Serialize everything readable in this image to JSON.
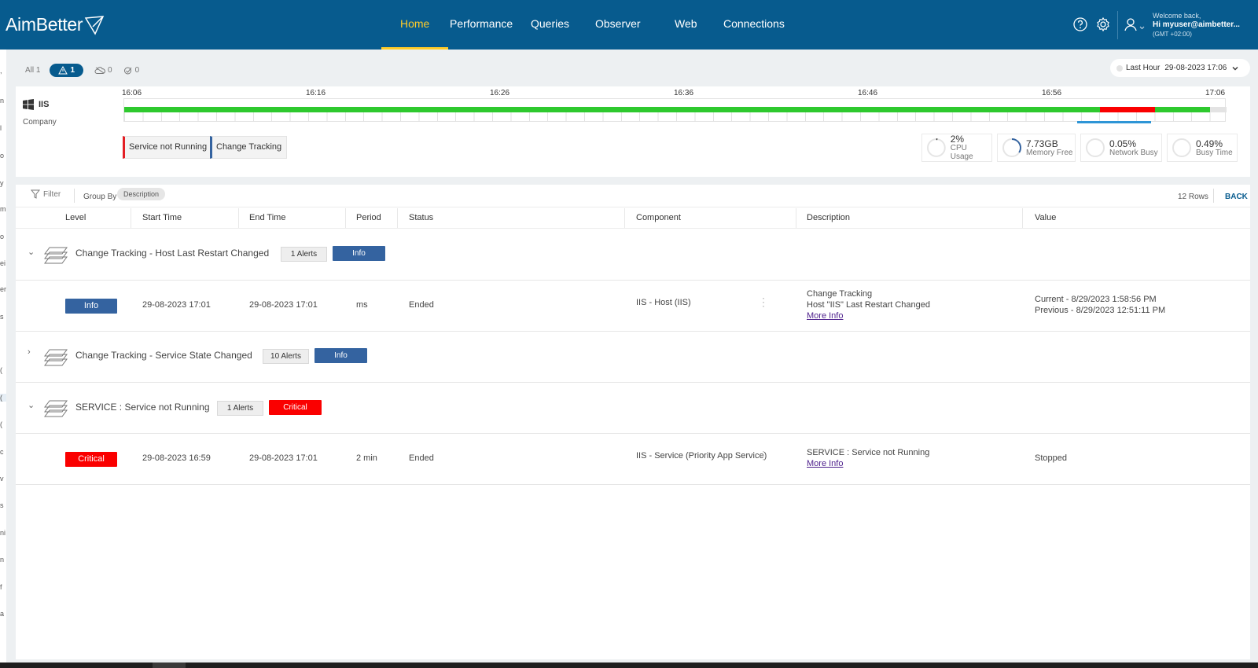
{
  "brand": {
    "logo": "AimBetter"
  },
  "nav": {
    "items": [
      "Home",
      "Performance",
      "Queries",
      "Observer",
      "Web",
      "Connections"
    ],
    "active": "Home"
  },
  "user": {
    "welcome": "Welcome back,",
    "name": "Hi myuser@aimbetter...",
    "timezone": "(GMT +02:00)"
  },
  "filters": {
    "all": "All 1",
    "alerts": "1",
    "cloud": "0",
    "resolved": "0"
  },
  "time_range": {
    "label": "Last Hour",
    "value": "29-08-2023 17:06"
  },
  "server": {
    "name": "IIS",
    "company": "Company",
    "ticks": [
      "16:06",
      "16:16",
      "16:26",
      "16:36",
      "16:46",
      "16:56",
      "17:06"
    ],
    "legend": [
      {
        "label": "Service not Running",
        "color": "#e31e24"
      },
      {
        "label": "Change Tracking",
        "color": "#3463a0"
      }
    ],
    "metrics": [
      {
        "value": "2%",
        "label": "CPU Usage",
        "fraction": 0.02
      },
      {
        "value": "7.73GB",
        "label": "Memory Free",
        "fraction": 0.35
      },
      {
        "value": "0.05%",
        "label": "Network Busy",
        "fraction": 0.0005
      },
      {
        "value": "0.49%",
        "label": "Busy Time",
        "fraction": 0.0049
      }
    ]
  },
  "grid": {
    "filter_label": "Filter",
    "group_by_label": "Group By",
    "group_by_value": "Description",
    "rows_count": "12 Rows",
    "back_label": "BACK",
    "columns": [
      "Level",
      "Start Time",
      "End Time",
      "Period",
      "Status",
      "Component",
      "Description",
      "Value"
    ],
    "groups": [
      {
        "title": "Change Tracking - Host Last Restart Changed",
        "count": "1 Alerts",
        "level": "Info",
        "detail": {
          "level": "Info",
          "start": "29-08-2023 17:01",
          "end": "29-08-2023 17:01",
          "period": "ms",
          "status": "Ended",
          "component": "IIS - Host (IIS)",
          "desc1": "Change Tracking",
          "desc2": "Host \"IIS\" Last Restart Changed",
          "more": "More Info",
          "value1": "Current - 8/29/2023 1:58:56 PM",
          "value2": "Previous - 8/29/2023 12:51:11 PM"
        }
      },
      {
        "title": "Change Tracking - Service State Changed",
        "count": "10 Alerts",
        "level": "Info"
      },
      {
        "title": "SERVICE : Service not Running",
        "count": "1 Alerts",
        "level": "Critical",
        "detail": {
          "level": "Critical",
          "start": "29-08-2023 16:59",
          "end": "29-08-2023 17:01",
          "period": "2 min",
          "status": "Ended",
          "component": "IIS - Service (Priority App Service)",
          "desc1": "SERVICE : Service not Running",
          "more": "More Info",
          "value1": "Stopped"
        }
      }
    ]
  },
  "colors": {
    "header": "#075b8e",
    "active_nav": "#ffcc29",
    "ok": "#2ec92e",
    "critical": "#fa0000",
    "info": "#3463a0",
    "link": "#4d1f8c"
  }
}
